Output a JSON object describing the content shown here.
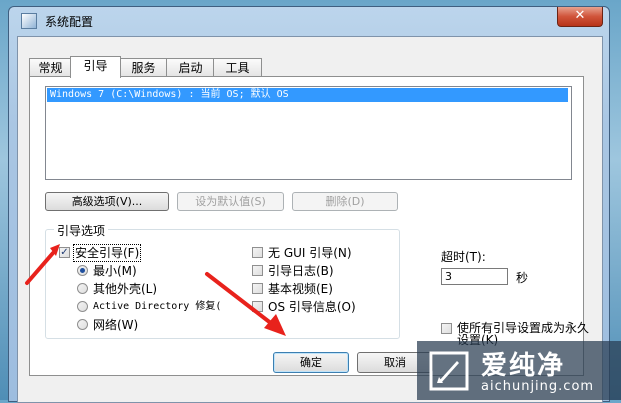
{
  "window": {
    "title": "系统配置",
    "close_label": "✕"
  },
  "tabs": [
    {
      "label": "常规",
      "active": false
    },
    {
      "label": "引导",
      "active": true
    },
    {
      "label": "服务",
      "active": false
    },
    {
      "label": "启动",
      "active": false
    },
    {
      "label": "工具",
      "active": false
    }
  ],
  "boot_list": {
    "items": [
      "Windows 7 (C:\\Windows) : 当前 OS; 默认 OS"
    ],
    "selected_index": 0
  },
  "buttons": {
    "advanced": "高级选项(V)...",
    "set_default": "设为默认值(S)",
    "delete": "删除(D)",
    "ok": "确定",
    "cancel": "取消"
  },
  "boot_options": {
    "title": "引导选项",
    "safe_boot": {
      "label": "安全引导(F)",
      "checked": true
    },
    "radios": [
      {
        "label": "最小(M)",
        "selected": true
      },
      {
        "label": "其他外壳(L)",
        "selected": false
      },
      {
        "label": "Active Directory 修复(",
        "selected": false
      },
      {
        "label": "网络(W)",
        "selected": false
      }
    ],
    "checkboxes": [
      {
        "label": "无 GUI 引导(N)",
        "checked": false
      },
      {
        "label": "引导日志(B)",
        "checked": false
      },
      {
        "label": "基本视频(E)",
        "checked": false
      },
      {
        "label": "OS 引导信息(O)",
        "checked": false
      }
    ]
  },
  "timeout": {
    "label": "超时(T):",
    "value": "3",
    "unit": "秒"
  },
  "permanent": {
    "label_line1": "使所有引导设置成为永久",
    "label_line2": "设置(K)",
    "checked": false
  },
  "watermark": {
    "brand": "爱纯净",
    "url": "aichunjing.com"
  },
  "colors": {
    "selection": "#3399ff",
    "arrow": "#e8221c"
  }
}
